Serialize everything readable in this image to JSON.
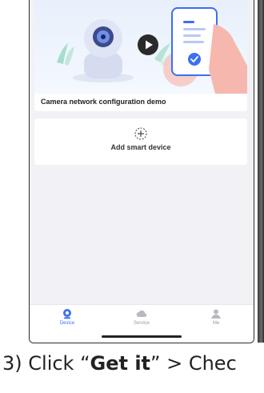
{
  "demo": {
    "title": "Camera network configuration demo",
    "play_icon": "play-icon"
  },
  "add_device": {
    "label": "Add smart device",
    "icon": "plus-circle-icon"
  },
  "tabs": [
    {
      "label": "Device",
      "icon": "device-icon",
      "active": true
    },
    {
      "label": "Service",
      "icon": "cloud-icon",
      "active": false
    },
    {
      "label": "Me",
      "icon": "person-icon",
      "active": false
    }
  ],
  "caption": {
    "prefix": "3) Click “",
    "bold": "Get it",
    "suffix": "” > Chec"
  },
  "colors": {
    "accent": "#3b6ff2",
    "background": "#f1f1f6"
  }
}
